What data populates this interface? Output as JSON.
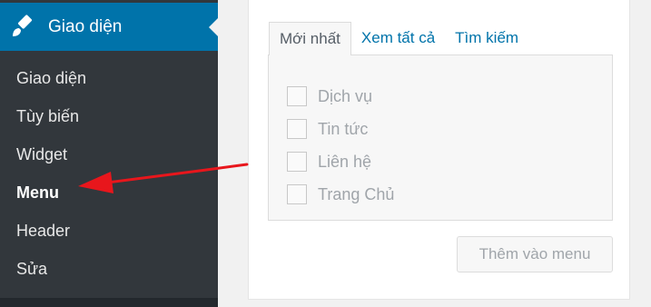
{
  "sidebar": {
    "header": {
      "label": "Giao diện",
      "icon": "paintbrush-icon"
    },
    "items": [
      {
        "label": "Giao diện"
      },
      {
        "label": "Tùy biến"
      },
      {
        "label": "Widget"
      },
      {
        "label": "Menu",
        "current": true
      },
      {
        "label": "Header"
      },
      {
        "label": "Sửa"
      }
    ]
  },
  "panel": {
    "tabs": [
      {
        "label": "Mới nhất",
        "active": true
      },
      {
        "label": "Xem tất cả"
      },
      {
        "label": "Tìm kiếm"
      }
    ],
    "items": [
      {
        "label": "Dịch vụ",
        "checked": false
      },
      {
        "label": "Tin tức",
        "checked": false
      },
      {
        "label": "Liên hệ",
        "checked": false
      },
      {
        "label": "Trang Chủ",
        "checked": false
      }
    ],
    "add_button": "Thêm vào menu"
  },
  "annotation": {
    "type": "arrow",
    "color": "#e8161c",
    "points_to": "Menu"
  },
  "colors": {
    "sidebar_bg": "#32373c",
    "active_menu": "#0073aa",
    "link": "#0073aa",
    "arrow": "#e8161c"
  }
}
